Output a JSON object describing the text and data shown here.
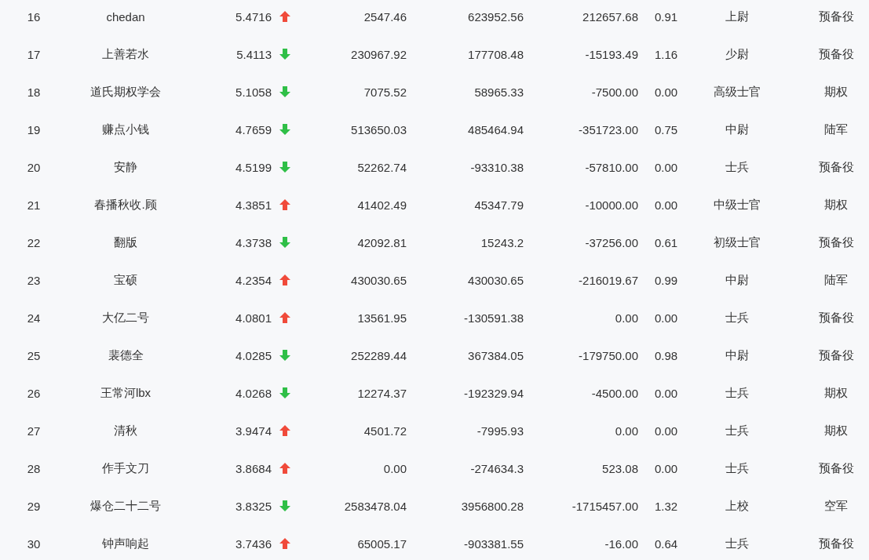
{
  "rows": [
    {
      "rank": "16",
      "name": "chedan",
      "score": "5.4716",
      "rising": true,
      "col_4": "2547.46",
      "col_5": "623952.56",
      "col_6": "212657.68",
      "col_7": "0.91",
      "rank_title": "上尉",
      "col_9": "预备役"
    },
    {
      "rank": "17",
      "name": "上善若水",
      "score": "5.4113",
      "rising": false,
      "col_4": "230967.92",
      "col_5": "177708.48",
      "col_6": "-15193.49",
      "col_7": "1.16",
      "rank_title": "少尉",
      "col_9": "预备役"
    },
    {
      "rank": "18",
      "name": "道氏期权学会",
      "score": "5.1058",
      "rising": false,
      "col_4": "7075.52",
      "col_5": "58965.33",
      "col_6": "-7500.00",
      "col_7": "0.00",
      "rank_title": "高级士官",
      "col_9": "期权"
    },
    {
      "rank": "19",
      "name": "赚点小钱",
      "score": "4.7659",
      "rising": false,
      "col_4": "513650.03",
      "col_5": "485464.94",
      "col_6": "-351723.00",
      "col_7": "0.75",
      "rank_title": "中尉",
      "col_9": "陆军"
    },
    {
      "rank": "20",
      "name": "安静",
      "score": "4.5199",
      "rising": false,
      "col_4": "52262.74",
      "col_5": "-93310.38",
      "col_6": "-57810.00",
      "col_7": "0.00",
      "rank_title": "士兵",
      "col_9": "预备役"
    },
    {
      "rank": "21",
      "name": "春播秋收.顾",
      "score": "4.3851",
      "rising": true,
      "col_4": "41402.49",
      "col_5": "45347.79",
      "col_6": "-10000.00",
      "col_7": "0.00",
      "rank_title": "中级士官",
      "col_9": "期权"
    },
    {
      "rank": "22",
      "name": "翻版",
      "score": "4.3738",
      "rising": false,
      "col_4": "42092.81",
      "col_5": "15243.2",
      "col_6": "-37256.00",
      "col_7": "0.61",
      "rank_title": "初级士官",
      "col_9": "预备役"
    },
    {
      "rank": "23",
      "name": "宝硕",
      "score": "4.2354",
      "rising": true,
      "col_4": "430030.65",
      "col_5": "430030.65",
      "col_6": "-216019.67",
      "col_7": "0.99",
      "rank_title": "中尉",
      "col_9": "陆军"
    },
    {
      "rank": "24",
      "name": "大亿二号",
      "score": "4.0801",
      "rising": true,
      "col_4": "13561.95",
      "col_5": "-130591.38",
      "col_6": "0.00",
      "col_7": "0.00",
      "rank_title": "士兵",
      "col_9": "预备役"
    },
    {
      "rank": "25",
      "name": "裴德全",
      "score": "4.0285",
      "rising": false,
      "col_4": "252289.44",
      "col_5": "367384.05",
      "col_6": "-179750.00",
      "col_7": "0.98",
      "rank_title": "中尉",
      "col_9": "预备役"
    },
    {
      "rank": "26",
      "name": "王常河lbx",
      "score": "4.0268",
      "rising": false,
      "col_4": "12274.37",
      "col_5": "-192329.94",
      "col_6": "-4500.00",
      "col_7": "0.00",
      "rank_title": "士兵",
      "col_9": "期权"
    },
    {
      "rank": "27",
      "name": "清秋",
      "score": "3.9474",
      "rising": true,
      "col_4": "4501.72",
      "col_5": "-7995.93",
      "col_6": "0.00",
      "col_7": "0.00",
      "rank_title": "士兵",
      "col_9": "期权"
    },
    {
      "rank": "28",
      "name": "作手文刀",
      "score": "3.8684",
      "rising": true,
      "col_4": "0.00",
      "col_5": "-274634.3",
      "col_6": "523.08",
      "col_7": "0.00",
      "rank_title": "士兵",
      "col_9": "预备役"
    },
    {
      "rank": "29",
      "name": "爆仓二十二号",
      "score": "3.8325",
      "rising": false,
      "col_4": "2583478.04",
      "col_5": "3956800.28",
      "col_6": "-1715457.00",
      "col_7": "1.32",
      "rank_title": "上校",
      "col_9": "空军"
    },
    {
      "rank": "30",
      "name": "钟声响起",
      "score": "3.7436",
      "rising": true,
      "col_4": "65005.17",
      "col_5": "-903381.55",
      "col_6": "-16.00",
      "col_7": "0.64",
      "rank_title": "士兵",
      "col_9": "预备役"
    }
  ]
}
